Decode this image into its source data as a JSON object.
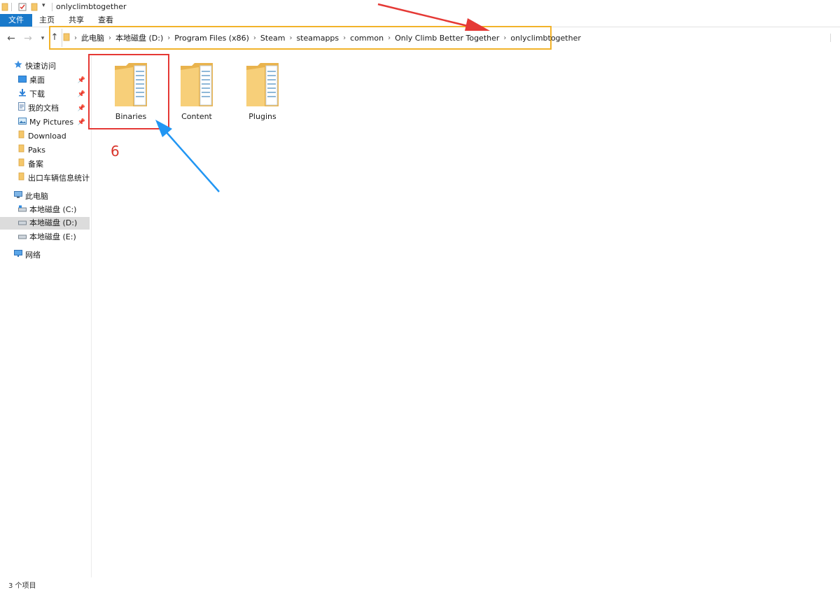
{
  "window": {
    "title": "onlyclimbtogether"
  },
  "ribbon": {
    "tabs": [
      {
        "label": "文件",
        "active": true
      },
      {
        "label": "主页"
      },
      {
        "label": "共享"
      },
      {
        "label": "查看"
      }
    ]
  },
  "nav_buttons": {
    "back": "back-arrow",
    "forward": "forward-arrow",
    "recent": "chevron-down",
    "up": "up-arrow"
  },
  "address": {
    "crumbs": [
      "此电脑",
      "本地磁盘 (D:)",
      "Program Files (x86)",
      "Steam",
      "steamapps",
      "common",
      "Only Climb Better Together",
      "onlyclimbtogether"
    ]
  },
  "navpane": {
    "quick_access": {
      "label": "快速访问",
      "items": [
        {
          "label": "桌面",
          "icon": "desktop-icon",
          "pinned": true
        },
        {
          "label": "下载",
          "icon": "download-icon",
          "pinned": true
        },
        {
          "label": "我的文档",
          "icon": "documents-icon",
          "pinned": true
        },
        {
          "label": "My Pictures",
          "icon": "pictures-icon",
          "pinned": true
        },
        {
          "label": "Download",
          "icon": "folder-icon"
        },
        {
          "label": "Paks",
          "icon": "folder-icon"
        },
        {
          "label": "备案",
          "icon": "folder-icon"
        },
        {
          "label": "出口车辆信息统计",
          "icon": "folder-icon"
        }
      ]
    },
    "this_pc": {
      "label": "此电脑",
      "drives": [
        {
          "label": "本地磁盘 (C:)",
          "icon": "system-drive-icon"
        },
        {
          "label": "本地磁盘 (D:)",
          "icon": "drive-icon",
          "selected": true
        },
        {
          "label": "本地磁盘 (E:)",
          "icon": "drive-icon"
        }
      ]
    },
    "network": {
      "label": "网络",
      "icon": "network-icon"
    }
  },
  "content": {
    "items": [
      {
        "label": "Binaries",
        "icon": "folder-icon"
      },
      {
        "label": "Content",
        "icon": "folder-icon"
      },
      {
        "label": "Plugins",
        "icon": "folder-icon"
      }
    ]
  },
  "annotations": {
    "step_number": "6",
    "highlight_color": "#e53935",
    "address_highlight_color": "#f2b32a",
    "arrow_colors": [
      "#e53935",
      "#2196f3"
    ]
  },
  "statusbar": {
    "text": "3 个项目"
  },
  "colors": {
    "file_tab": "#1979ca",
    "folder": "#f5c76a",
    "selected_nav": "#dcdcdc"
  }
}
